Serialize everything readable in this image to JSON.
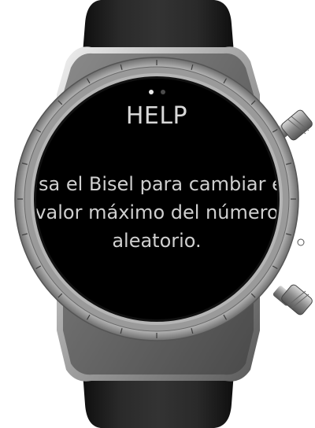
{
  "screen": {
    "title": "HELP",
    "message": "Usa el Bisel para cambiar el valor máximo del número aleatorio.",
    "page_indicator": {
      "count": 2,
      "active": 1
    }
  },
  "colors": {
    "screen_bg": "#000000",
    "text": "#cfcfcf",
    "bezel": "#9a9a9a",
    "strap": "#1e1e1e"
  },
  "icons": [
    "crown-top-button",
    "crown-bottom-button",
    "bezel-marker"
  ]
}
